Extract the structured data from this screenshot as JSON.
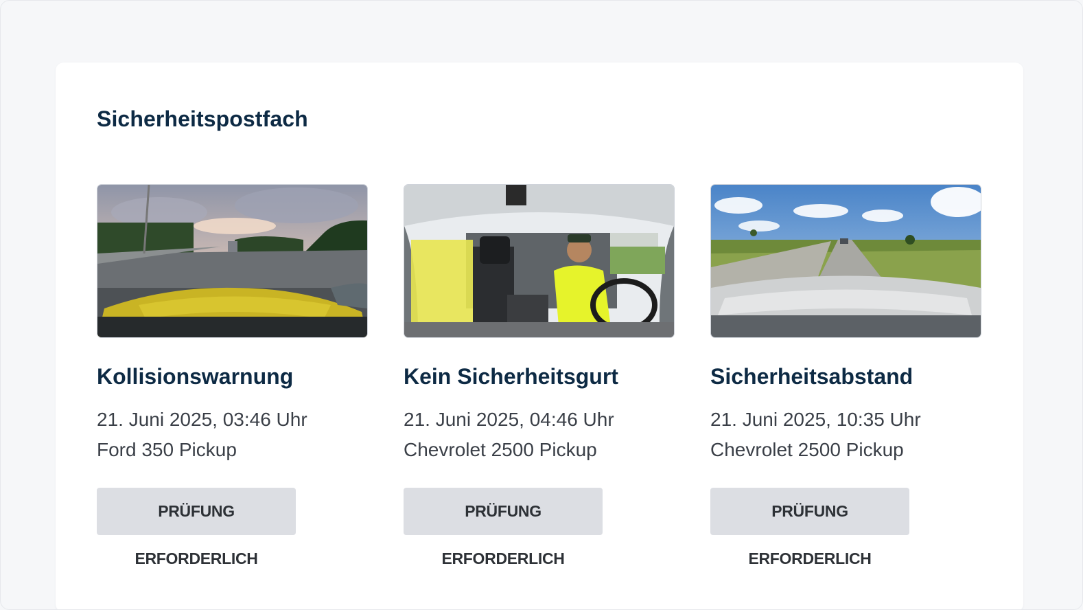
{
  "inbox": {
    "title": "Sicherheitspostfach"
  },
  "events": [
    {
      "title": "Kollisionswarnung",
      "datetime": "21. Juni 2025, 03:46 Uhr",
      "vehicle": "Ford 350 Pickup",
      "status": "PRÜFUNG ERFORDERLICH"
    },
    {
      "title": "Kein Sicherheitsgurt",
      "datetime": "21. Juni 2025, 04:46 Uhr",
      "vehicle": "Chevrolet 2500 Pickup",
      "status": "PRÜFUNG ERFORDERLICH"
    },
    {
      "title": "Sicherheitsabstand",
      "datetime": "21. Juni 2025, 10:35 Uhr",
      "vehicle": "Chevrolet 2500 Pickup",
      "status": "PRÜFUNG ERFORDERLICH"
    }
  ],
  "colors": {
    "heading": "#0d2a44",
    "badge_bg": "#dcdee3",
    "badge_text": "#2d3136"
  }
}
